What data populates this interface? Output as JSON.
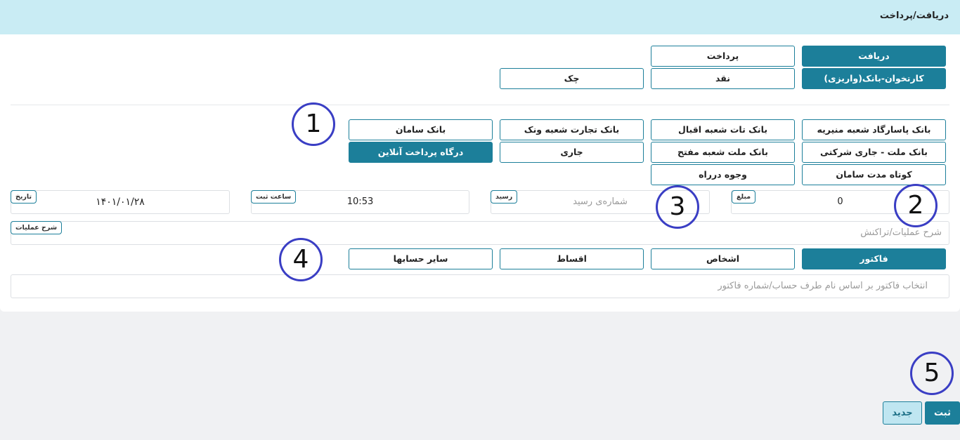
{
  "header": {
    "title": "دریافت/پرداخت"
  },
  "type_toggle": {
    "receive": "دریافت",
    "pay": "پرداخت"
  },
  "method_toggle": {
    "card_bank": "کارتخوان-بانک(واریزی)",
    "cash": "نقد",
    "cheque": "چک"
  },
  "banks": [
    "بانک پاسارگاد شعبه منیریه",
    "بانک تات شعبه اقبال",
    "بانک تجارت شعبه ونک",
    "بانک سامان",
    "بانک ملت - جاری شرکتی",
    "بانک ملت شعبه مفتح",
    "جاری",
    "درگاه پرداخت آنلاین",
    "کوتاه مدت سامان",
    "وجوه درراه"
  ],
  "fields": {
    "amount_label": "مبلغ",
    "amount_value": "0",
    "receipt_label": "رسید",
    "receipt_placeholder": "شماره‌ی رسید",
    "time_label": "ساعت ثبت",
    "time_value": "10:53",
    "date_label": "تاریخ",
    "date_value": "۱۴۰۱/۰۱/۲۸",
    "description_label": "شرح عملیات",
    "description_placeholder": "شرح عملیات/تراکنش"
  },
  "target_tabs": {
    "invoice": "فاکتور",
    "persons": "اشخاص",
    "installments": "اقساط",
    "other_accounts": "سایر حسابها"
  },
  "invoice_search": {
    "placeholder": "انتخاب فاکتور بر اساس نام طرف حساب/شماره فاکتور"
  },
  "actions": {
    "submit": "ثبت",
    "new": "جدید"
  },
  "annotations": [
    "1",
    "2",
    "3",
    "4",
    "5"
  ],
  "colors": {
    "accent": "#1c7f9a",
    "header_bg": "#c9ecf4",
    "annotation_ring": "#3a3ec4"
  }
}
